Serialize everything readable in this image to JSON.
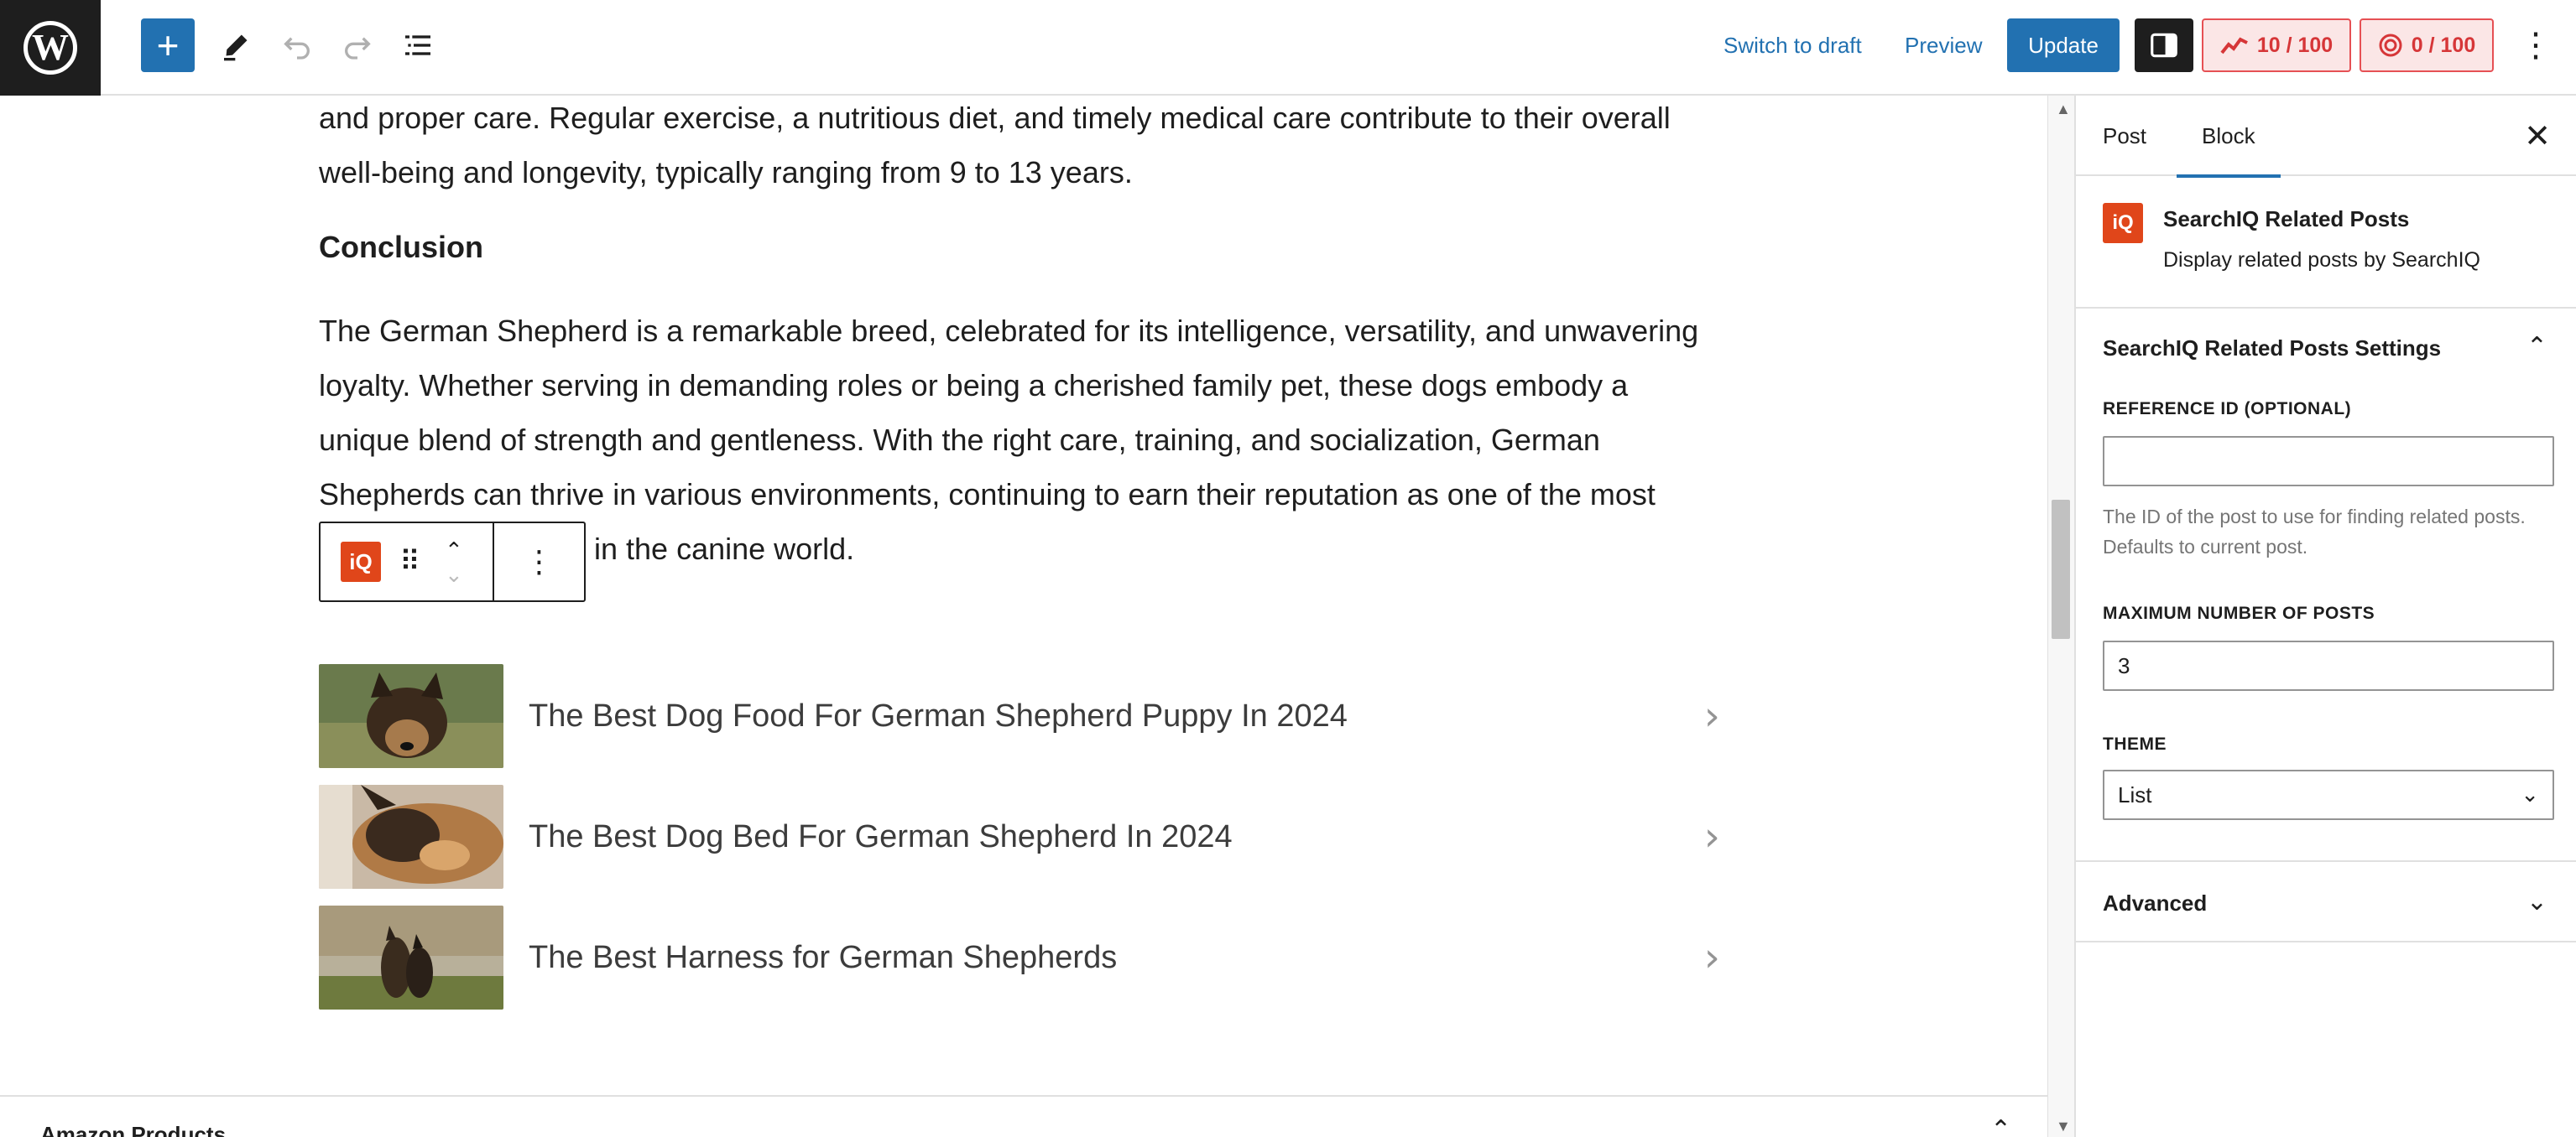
{
  "toolbar": {
    "logo_glyph": "W",
    "add_glyph": "+",
    "switch_draft": "Switch to draft",
    "preview": "Preview",
    "update": "Update",
    "seo_score": "10 / 100",
    "readability_score": "0 / 100",
    "icons": [
      "wordpress-logo-icon",
      "plus-icon",
      "pencil-icon",
      "undo-icon",
      "redo-icon",
      "list-view-icon",
      "sidebar-icon",
      "seo-score-icon",
      "readability-score-icon",
      "kebab-icon"
    ]
  },
  "editor": {
    "para1_line1": "and proper care. Regular exercise, a nutritious diet, and timely medical care contribute to their overall",
    "para1_line2": "well-being and longevity, typically ranging from 9 to 13 years.",
    "heading": "Conclusion",
    "para2_line1": "The German Shepherd is a remarkable breed, celebrated for its intelligence, versatility, and unwavering",
    "para2_line2": "loyalty. Whether serving in demanding roles or being a cherished family pet, these dogs embody a",
    "para2_line3": "unique blend of strength and gentleness. With the right care, training, and socialization, German",
    "para2_line4": "Shepherds can thrive in various environments, continuing to earn their reputation as one of the most",
    "para2_line5": "in the canine world.",
    "block_icon_text": "iQ",
    "related_posts": [
      {
        "title": "The Best Dog Food For German Shepherd Puppy In 2024"
      },
      {
        "title": "The Best Dog Bed For German Shepherd In 2024"
      },
      {
        "title": "The Best Harness for German Shepherds"
      }
    ],
    "amazon_panel": "Amazon Products"
  },
  "sidebar": {
    "tab_post": "Post",
    "tab_block": "Block",
    "block_icon_text": "iQ",
    "block_name": "SearchIQ Related Posts",
    "block_desc": "Display related posts by SearchIQ",
    "settings_title": "SearchIQ Related Posts Settings",
    "ref_label": "REFERENCE ID (OPTIONAL)",
    "ref_value": "",
    "ref_help": "The ID of the post to use for finding related posts. Defaults to current post.",
    "max_label": "MAXIMUM NUMBER OF POSTS",
    "max_value": "3",
    "theme_label": "THEME",
    "theme_value": "List",
    "advanced": "Advanced"
  },
  "colors": {
    "accent": "#2271b1",
    "searchiq": "#e0461a",
    "score_red": "#d63638",
    "dark": "#1e1e1e"
  }
}
